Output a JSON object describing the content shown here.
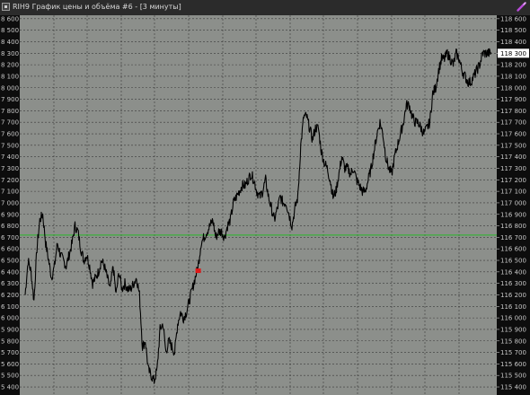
{
  "window": {
    "title": "RIH9 График цены и объёма #6 - [3 минуты]"
  },
  "toolbar": {
    "pen_icon": "pen-icon"
  },
  "colors": {
    "background": "#8c8f8b",
    "price_line": "#000000",
    "level_line": "#28b828",
    "marker": "#e01818",
    "axis_bg": "#0d0d0d",
    "axis_text": "#c8c8c8",
    "price_tag_bg": "#ffffff"
  },
  "chart_data": {
    "type": "line",
    "instrument": "RIH9",
    "timeframe": "3 минуты",
    "ylim": [
      115330,
      118630
    ],
    "left_ticks": [
      "8 600",
      "8 500",
      "8 400",
      "8 300",
      "8 200",
      "8 100",
      "8 000",
      "7 900",
      "7 800",
      "7 700",
      "7 600",
      "7 500",
      "7 400",
      "7 300",
      "7 200",
      "7 100",
      "7 000",
      "6 900",
      "6 800",
      "6 700",
      "6 600",
      "6 500",
      "6 400",
      "6 300",
      "6 200",
      "6 100",
      "6 000",
      "5 900",
      "5 800",
      "5 700",
      "5 600",
      "5 500",
      "5 400"
    ],
    "right_ticks": [
      "118 600",
      "118 500",
      "118 400",
      "118 300",
      "118 200",
      "118 100",
      "118 000",
      "117 900",
      "117 800",
      "117 700",
      "117 600",
      "117 500",
      "117 400",
      "117 300",
      "117 200",
      "117 100",
      "117 000",
      "116 900",
      "116 800",
      "116 700",
      "116 600",
      "116 500",
      "116 400",
      "116 300",
      "116 200",
      "116 100",
      "116 000",
      "115 900",
      "115 800",
      "115 700",
      "115 600",
      "115 500",
      "115 400"
    ],
    "current_price_label": "118 300",
    "current_price": 118300,
    "horizontal_level": 116720,
    "marker": {
      "bar": 59,
      "price": 116410
    },
    "bars": 160,
    "series": [
      {
        "values": [
          116200,
          116500,
          116400,
          116150,
          116600,
          116850,
          116900,
          116650,
          116500,
          116350,
          116450,
          116650,
          116550,
          116500,
          116450,
          116550,
          116650,
          116800,
          116750,
          116600,
          116500,
          116550,
          116450,
          116300,
          116350,
          116400,
          116500,
          116450,
          116350,
          116250,
          116450,
          116200,
          116400,
          116250,
          116300,
          116250,
          116250,
          116300,
          116350,
          116200,
          115750,
          115800,
          115550,
          115500,
          115450,
          115550,
          115900,
          115950,
          115700,
          115800,
          115750,
          115700,
          115950,
          116050,
          116000,
          116050,
          116150,
          116250,
          116350,
          116450,
          116650,
          116700,
          116750,
          116800,
          116850,
          116700,
          116750,
          116750,
          116700,
          116800,
          116850,
          117000,
          117050,
          117100,
          117150,
          117150,
          117200,
          117250,
          117200,
          117100,
          117050,
          117100,
          117200,
          117050,
          116950,
          116850,
          116950,
          117050,
          117000,
          117000,
          116900,
          116800,
          116950,
          117050,
          117500,
          117750,
          117750,
          117650,
          117550,
          117650,
          117650,
          117450,
          117350,
          117300,
          117200,
          117050,
          117100,
          117250,
          117400,
          117300,
          117300,
          117250,
          117300,
          117200,
          117150,
          117100,
          117100,
          117200,
          117300,
          117450,
          117600,
          117700,
          117600,
          117400,
          117300,
          117250,
          117400,
          117500,
          117600,
          117700,
          117850,
          117850,
          117750,
          117700,
          117700,
          117650,
          117600,
          117650,
          117700,
          117950,
          118000,
          118150,
          118250,
          118250,
          118300,
          118250,
          118200,
          118300,
          118250,
          118150,
          118100,
          118050,
          118050,
          118100,
          118150,
          118200,
          118300,
          118300,
          118300,
          118300
        ]
      }
    ]
  }
}
